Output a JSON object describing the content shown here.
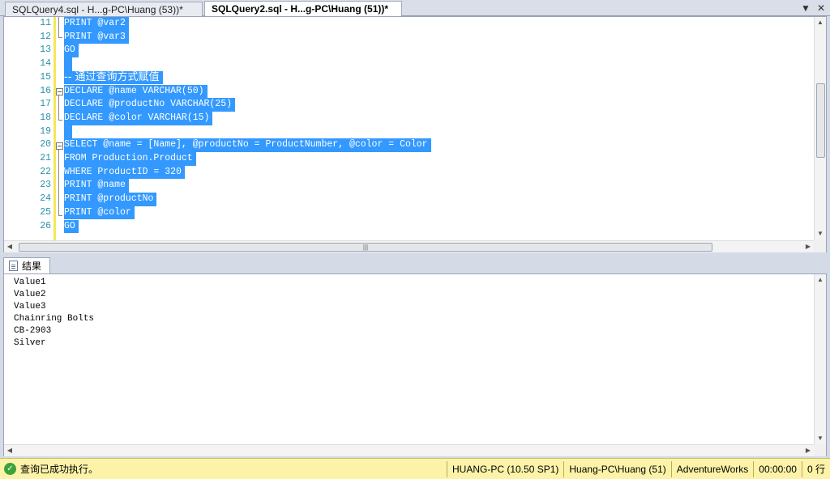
{
  "tabs": [
    {
      "label": "SQLQuery4.sql - H...g-PC\\Huang (53))*",
      "active": false
    },
    {
      "label": "SQLQuery2.sql - H...g-PC\\Huang (51))*",
      "active": true
    }
  ],
  "tabbar_icons": {
    "dropdown": "▼",
    "close": "✕"
  },
  "editor": {
    "lines": [
      {
        "num": "11",
        "text": "PRINT @var2"
      },
      {
        "num": "12",
        "text": "PRINT @var3"
      },
      {
        "num": "13",
        "text": "GO"
      },
      {
        "num": "14",
        "text": ""
      },
      {
        "num": "15",
        "text": "-- 通过查询方式赋值"
      },
      {
        "num": "16",
        "text": "DECLARE @name VARCHAR(50)"
      },
      {
        "num": "17",
        "text": "DECLARE @productNo VARCHAR(25)"
      },
      {
        "num": "18",
        "text": "DECLARE @color VARCHAR(15)"
      },
      {
        "num": "19",
        "text": ""
      },
      {
        "num": "20",
        "text": "SELECT @name = [Name], @productNo = ProductNumber, @color = Color"
      },
      {
        "num": "21",
        "text": "FROM Production.Product"
      },
      {
        "num": "22",
        "text": "WHERE ProductID = 320"
      },
      {
        "num": "23",
        "text": "PRINT @name"
      },
      {
        "num": "24",
        "text": "PRINT @productNo"
      },
      {
        "num": "25",
        "text": "PRINT @color"
      },
      {
        "num": "26",
        "text": "GO"
      }
    ],
    "selection_color": "#3399ff",
    "line_number_color": "#2b91af"
  },
  "results": {
    "tab_label": "结果",
    "messages": [
      "Value1",
      "Value2",
      "Value3",
      "Chainring Bolts",
      "CB-2903",
      "Silver"
    ]
  },
  "statusbar": {
    "message": "查询已成功执行。",
    "server": "HUANG-PC (10.50 SP1)",
    "login": "Huang-PC\\Huang (51)",
    "database": "AdventureWorks",
    "elapsed": "00:00:00",
    "rows": "0 行",
    "background": "#fcf3a8"
  }
}
